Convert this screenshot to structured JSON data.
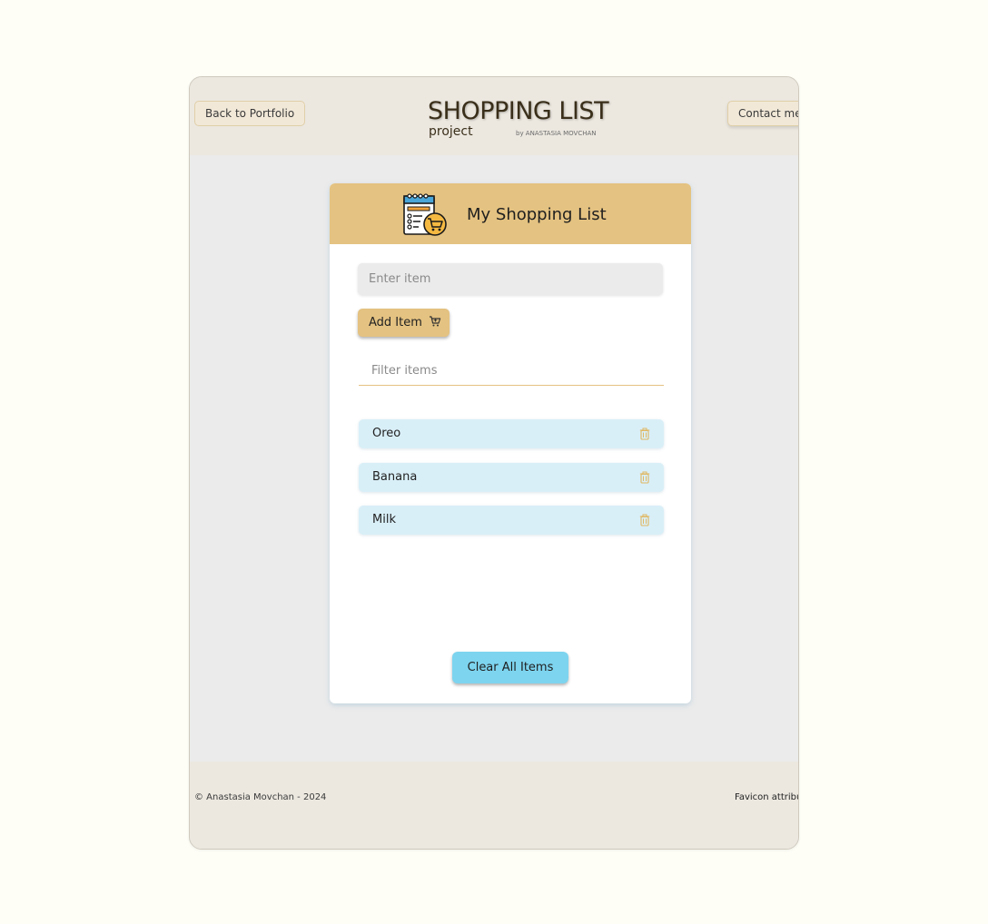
{
  "header": {
    "back_label": "Back to Portfolio",
    "contact_label": "Contact me",
    "logo": {
      "title": "SHOPPING LIST",
      "subtitle": "project",
      "byline": "by ANASTASIA MOVCHAN"
    }
  },
  "card": {
    "title": "My Shopping List",
    "header_icon": "shopping-list-icon",
    "item_input": {
      "placeholder": "Enter item",
      "value": ""
    },
    "add_button": {
      "label": "Add Item",
      "icon": "cart-icon"
    },
    "filter_input": {
      "placeholder": "Filter items",
      "value": ""
    },
    "items": [
      {
        "label": "Oreo",
        "icon": "trash-icon"
      },
      {
        "label": "Banana",
        "icon": "trash-icon"
      },
      {
        "label": "Milk",
        "icon": "trash-icon"
      }
    ],
    "clear_button": {
      "label": "Clear All Items"
    }
  },
  "footer": {
    "copyright": "© Anastasia Movchan - 2024",
    "favicon_attribution": "Favicon attribut"
  },
  "colors": {
    "page_background": "#fefef7",
    "header_footer_background": "#ece8e0",
    "content_background": "#ebebeb",
    "accent_gold": "#e4c281",
    "item_background": "#d9eff8",
    "clear_button": "#7dd4ef"
  }
}
